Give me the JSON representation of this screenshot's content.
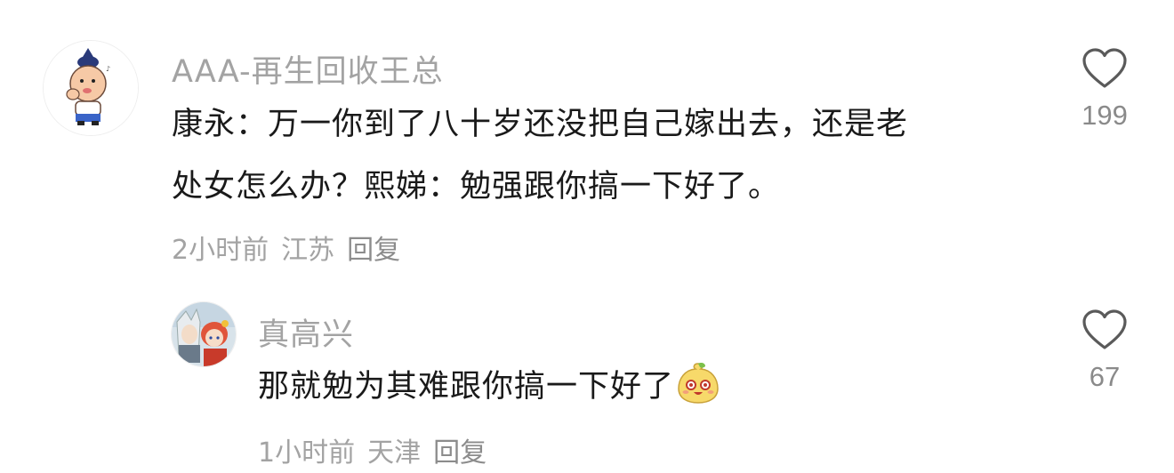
{
  "comments": [
    {
      "username": "AAA-再生回收王总",
      "text_line1": "康永：万一你到了八十岁还没把自己嫁出去，还是老",
      "text_line2": "处女怎么办？熙娣：勉强跟你搞一下好了。",
      "time": "2小时前",
      "location": "江苏",
      "reply_label": "回复",
      "like_count": "199",
      "avatar_icon": "cartoon-boy-avatar"
    },
    {
      "username": "真高兴",
      "text": "那就勉为其难跟你搞一下好了",
      "emoji_icon": "smiling-bun-emoji",
      "time": "1小时前",
      "location": "天津",
      "reply_label": "回复",
      "like_count": "67",
      "avatar_icon": "anime-characters-avatar"
    }
  ],
  "colors": {
    "secondary_text": "#a3a3a3",
    "primary_text": "#1a1a1a",
    "heart_stroke": "#5a5a5a"
  }
}
